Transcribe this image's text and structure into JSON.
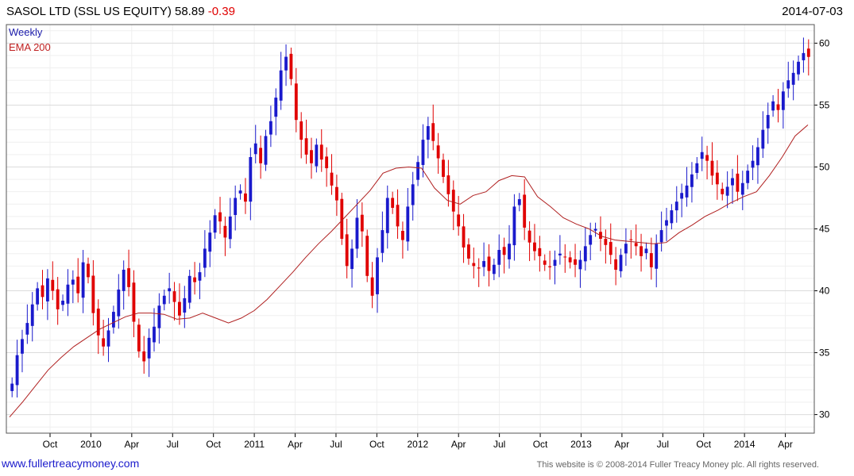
{
  "header": {
    "name": "SASOL LTD (SSL US EQUITY)",
    "price": "58.89",
    "change": "-0.39",
    "date": "2014-07-03"
  },
  "colors": {
    "up": "#1a1acc",
    "down": "#e00000",
    "ema": "#b02020",
    "grid": "#dcdcdc",
    "minor_grid": "#efefef"
  },
  "chart_data": {
    "type": "line",
    "legend": [
      "Weekly",
      "EMA 200"
    ],
    "legend_placement": "top-left",
    "y_axis_side": "right",
    "ylim": [
      28.5,
      61.5
    ],
    "y_ticks": [
      30,
      35,
      40,
      45,
      50,
      55,
      60
    ],
    "x_ticks": [
      "Oct",
      "2010",
      "Apr",
      "Jul",
      "Oct",
      "2011",
      "Apr",
      "Jul",
      "Oct",
      "2012",
      "Apr",
      "Jul",
      "Oct",
      "2013",
      "Apr",
      "Jul",
      "Oct",
      "2014",
      "Apr"
    ],
    "grid": true,
    "series": [
      {
        "name": "Weekly",
        "style": "candlestick",
        "values": [
          32.5,
          34.8,
          36.1,
          37.4,
          38.9,
          40.2,
          39.5,
          41.0,
          40.0,
          38.5,
          39.2,
          40.5,
          40.9,
          39.8,
          42.3,
          41.1,
          38.2,
          36.4,
          35.5,
          36.8,
          38.3,
          40.1,
          41.7,
          40.3,
          37.5,
          35.1,
          34.3,
          36.2,
          37.1,
          38.8,
          39.6,
          40.2,
          39.1,
          38.0,
          39.4,
          41.2,
          40.7,
          41.5,
          43.4,
          44.7,
          46.1,
          45.6,
          44.3,
          46.0,
          47.5,
          48.1,
          47.2,
          50.8,
          51.9,
          50.3,
          52.5,
          53.7,
          55.6,
          57.8,
          58.9,
          57.1,
          53.8,
          52.2,
          51.0,
          50.3,
          51.8,
          50.6,
          49.9,
          48.5,
          47.3,
          44.2,
          42.0,
          43.4,
          45.9,
          44.8,
          41.2,
          39.6,
          42.7,
          44.9,
          47.5,
          46.7,
          45.2,
          44.1,
          46.8,
          48.6,
          50.4,
          52.2,
          53.3,
          52.1,
          50.7,
          49.2,
          47.8,
          46.4,
          45.2,
          43.5,
          42.6,
          42.0,
          41.8,
          42.4,
          41.6,
          42.1,
          43.3,
          42.9,
          43.8,
          46.8,
          47.4,
          45.1,
          43.9,
          43.2,
          42.8,
          42.1,
          41.9,
          42.5,
          43.0,
          42.7,
          42.3,
          42.1,
          42.5,
          43.6,
          44.5,
          45.0,
          44.2,
          43.7,
          42.9,
          41.7,
          42.9,
          43.8,
          44.1,
          43.6,
          42.8,
          43.4,
          41.9,
          43.8,
          44.9,
          45.7,
          46.5,
          47.2,
          47.9,
          48.5,
          49.4,
          50.3,
          51.2,
          50.5,
          49.3,
          48.6,
          47.8,
          48.4,
          49.1,
          48.0,
          48.7,
          49.7,
          50.5,
          51.6,
          53.0,
          54.2,
          55.3,
          54.6,
          56.1,
          57.0,
          57.6,
          58.5,
          59.2,
          58.89
        ]
      },
      {
        "name": "EMA 200",
        "style": "line",
        "values": [
          29.8,
          31.0,
          32.3,
          33.6,
          34.6,
          35.5,
          36.2,
          36.9,
          37.4,
          37.9,
          38.2,
          38.2,
          38.1,
          37.7,
          37.8,
          38.2,
          37.8,
          37.4,
          37.8,
          38.4,
          39.3,
          40.4,
          41.5,
          42.7,
          43.8,
          44.8,
          45.9,
          47.0,
          48.1,
          49.5,
          49.9,
          50.0,
          49.9,
          48.3,
          47.3,
          47.0,
          47.7,
          48.0,
          48.9,
          49.3,
          49.2,
          47.6,
          46.8,
          45.9,
          45.4,
          45.0,
          44.4,
          44.1,
          44.0,
          43.9,
          43.8,
          43.9,
          44.7,
          45.3,
          46.0,
          46.5,
          47.1,
          47.6,
          48.0,
          49.3,
          50.8,
          52.5,
          53.4
        ]
      }
    ]
  },
  "footer": {
    "website": "www.fullertreacymoney.com",
    "copyright": "This website is © 2008-2014 Fuller Treacy Money plc. All rights reserved."
  }
}
